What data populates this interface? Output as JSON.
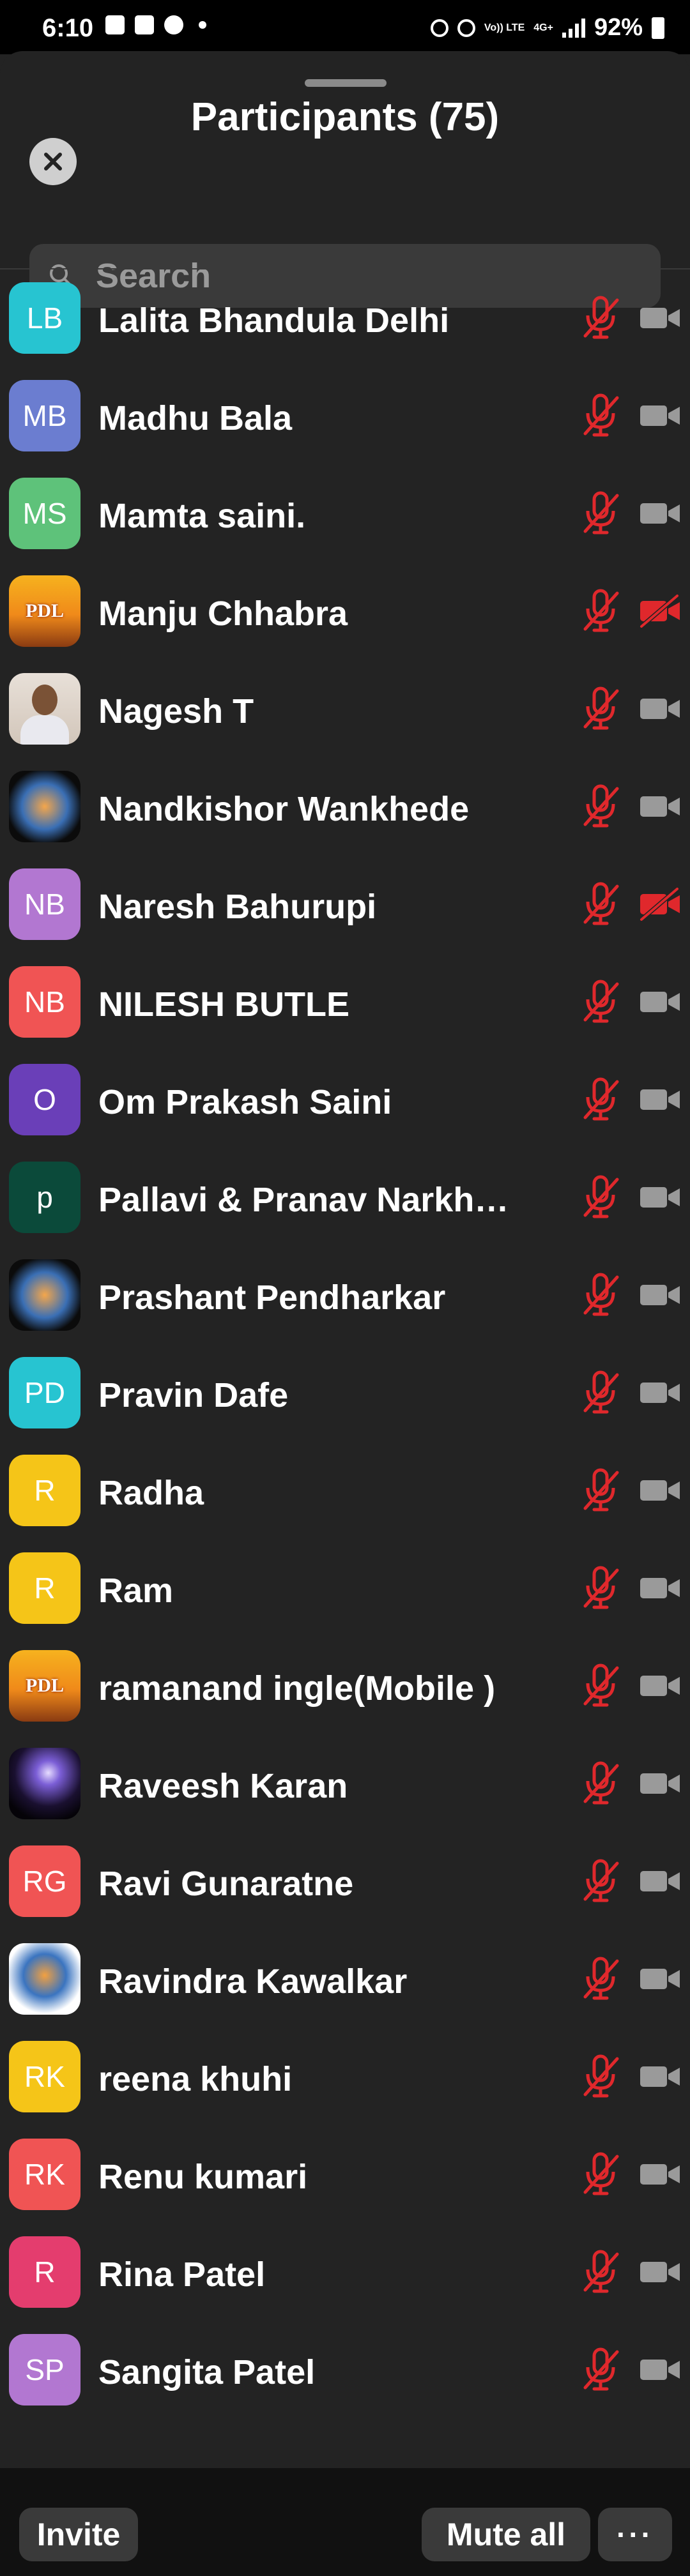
{
  "status_bar": {
    "time": "6:10",
    "battery": "92%",
    "network_label": "Vo)) LTE",
    "network_type": "4G+"
  },
  "header": {
    "title": "Participants (75)"
  },
  "search": {
    "placeholder": "Search"
  },
  "colors": {
    "background": "#232323",
    "muted_red": "#e0282c",
    "camera_gray": "#9a9a9a"
  },
  "participants": [
    {
      "name": "Lalita Bhandula Delhi",
      "initials": "LB",
      "avatar_color": "#27c4d1",
      "mic": "muted",
      "camera": "off-gray"
    },
    {
      "name": "Madhu Bala",
      "initials": "MB",
      "avatar_color": "#6b7dd0",
      "mic": "muted",
      "camera": "off-gray"
    },
    {
      "name": "Mamta saini.",
      "initials": "MS",
      "avatar_color": "#5ec27a",
      "mic": "muted",
      "camera": "off-gray"
    },
    {
      "name": "Manju Chhabra",
      "initials": "",
      "avatar_image": "pdl-logo",
      "mic": "muted",
      "camera": "off-red"
    },
    {
      "name": "Nagesh T",
      "initials": "",
      "avatar_image": "person-photo",
      "mic": "muted",
      "camera": "off-gray"
    },
    {
      "name": "Nandkishor Wankhede",
      "initials": "",
      "avatar_image": "org-emblem-dark",
      "mic": "muted",
      "camera": "off-gray"
    },
    {
      "name": "Naresh Bahurupi",
      "initials": "NB",
      "avatar_color": "#b277d1",
      "mic": "muted",
      "camera": "off-red"
    },
    {
      "name": "NILESH BUTLE",
      "initials": "NB",
      "avatar_color": "#f05454",
      "mic": "muted",
      "camera": "off-gray"
    },
    {
      "name": "Om Prakash Saini",
      "initials": "O",
      "avatar_color": "#6a3fb8",
      "mic": "muted",
      "camera": "off-gray"
    },
    {
      "name": "Pallavi & Pranav Narkhe…",
      "initials": "p",
      "avatar_color": "#0b4a3a",
      "mic": "muted",
      "camera": "off-gray"
    },
    {
      "name": "Prashant Pendharkar",
      "initials": "",
      "avatar_image": "org-emblem-dark",
      "mic": "muted",
      "camera": "off-gray"
    },
    {
      "name": "Pravin Dafe",
      "initials": "PD",
      "avatar_color": "#27c4d1",
      "mic": "muted",
      "camera": "off-gray"
    },
    {
      "name": "Radha",
      "initials": "R",
      "avatar_color": "#f5c518",
      "mic": "muted",
      "camera": "off-gray"
    },
    {
      "name": "Ram",
      "initials": "R",
      "avatar_color": "#f5c518",
      "mic": "muted",
      "camera": "off-gray"
    },
    {
      "name": "ramanand ingle(Mobile )",
      "initials": "",
      "avatar_image": "pdl-logo",
      "mic": "muted",
      "camera": "off-gray"
    },
    {
      "name": "Raveesh Karan",
      "initials": "",
      "avatar_image": "glow-photo",
      "mic": "muted",
      "camera": "off-gray"
    },
    {
      "name": "Ravi Gunaratne",
      "initials": "RG",
      "avatar_color": "#f05454",
      "mic": "muted",
      "camera": "off-gray"
    },
    {
      "name": "Ravindra Kawalkar",
      "initials": "",
      "avatar_image": "org-emblem-light",
      "mic": "muted",
      "camera": "off-gray"
    },
    {
      "name": "reena khuhi",
      "initials": "RK",
      "avatar_color": "#f5c518",
      "mic": "muted",
      "camera": "off-gray"
    },
    {
      "name": "Renu kumari",
      "initials": "RK",
      "avatar_color": "#f05454",
      "mic": "muted",
      "camera": "off-gray"
    },
    {
      "name": "Rina Patel",
      "initials": "R",
      "avatar_color": "#e43d6e",
      "mic": "muted",
      "camera": "off-gray"
    },
    {
      "name": "Sangita Patel",
      "initials": "SP",
      "avatar_color": "#b277d1",
      "mic": "muted",
      "camera": "off-gray"
    }
  ],
  "pdl_logo_text": "PDL",
  "footer": {
    "invite_label": "Invite",
    "mute_all_label": "Mute all",
    "more_label": "···"
  }
}
